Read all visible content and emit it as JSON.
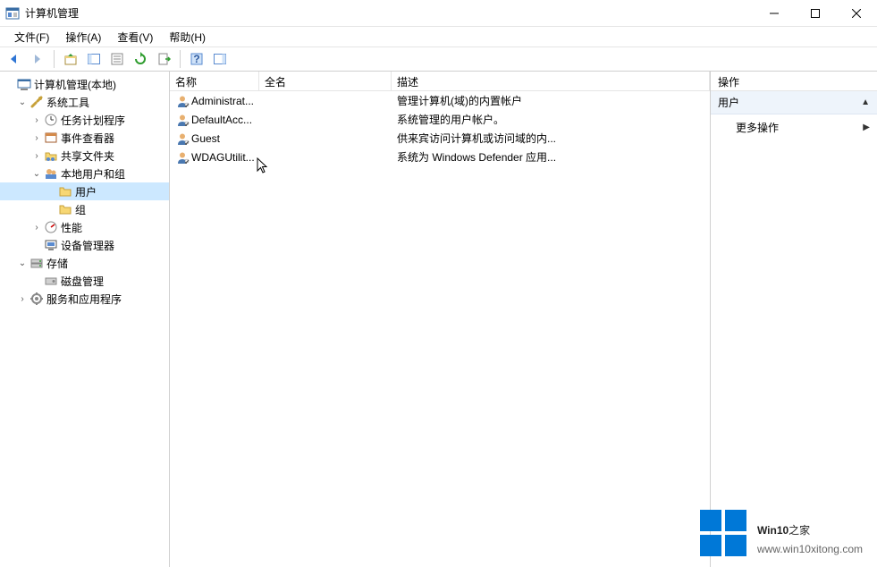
{
  "window": {
    "title": "计算机管理"
  },
  "menu": {
    "file": "文件(F)",
    "action": "操作(A)",
    "view": "查看(V)",
    "help": "帮助(H)"
  },
  "tree": {
    "root": "计算机管理(本地)",
    "system_tools": "系统工具",
    "task_scheduler": "任务计划程序",
    "event_viewer": "事件查看器",
    "shared_folders": "共享文件夹",
    "local_users_groups": "本地用户和组",
    "users": "用户",
    "groups": "组",
    "performance": "性能",
    "device_manager": "设备管理器",
    "storage": "存储",
    "disk_management": "磁盘管理",
    "services_apps": "服务和应用程序"
  },
  "columns": {
    "name": "名称",
    "fullname": "全名",
    "description": "描述"
  },
  "users": [
    {
      "name": "Administrat...",
      "fullname": "",
      "desc": "管理计算机(域)的内置帐户"
    },
    {
      "name": "DefaultAcc...",
      "fullname": "",
      "desc": "系统管理的用户帐户。"
    },
    {
      "name": "Guest",
      "fullname": "",
      "desc": "供来宾访问计算机或访问域的内..."
    },
    {
      "name": "WDAGUtilit...",
      "fullname": "",
      "desc": "系统为 Windows Defender 应用..."
    }
  ],
  "actions": {
    "header": "操作",
    "section": "用户",
    "more": "更多操作"
  },
  "watermark": {
    "brand1": "Win10",
    "brand2": "之家",
    "url": "www.win10xitong.com"
  }
}
